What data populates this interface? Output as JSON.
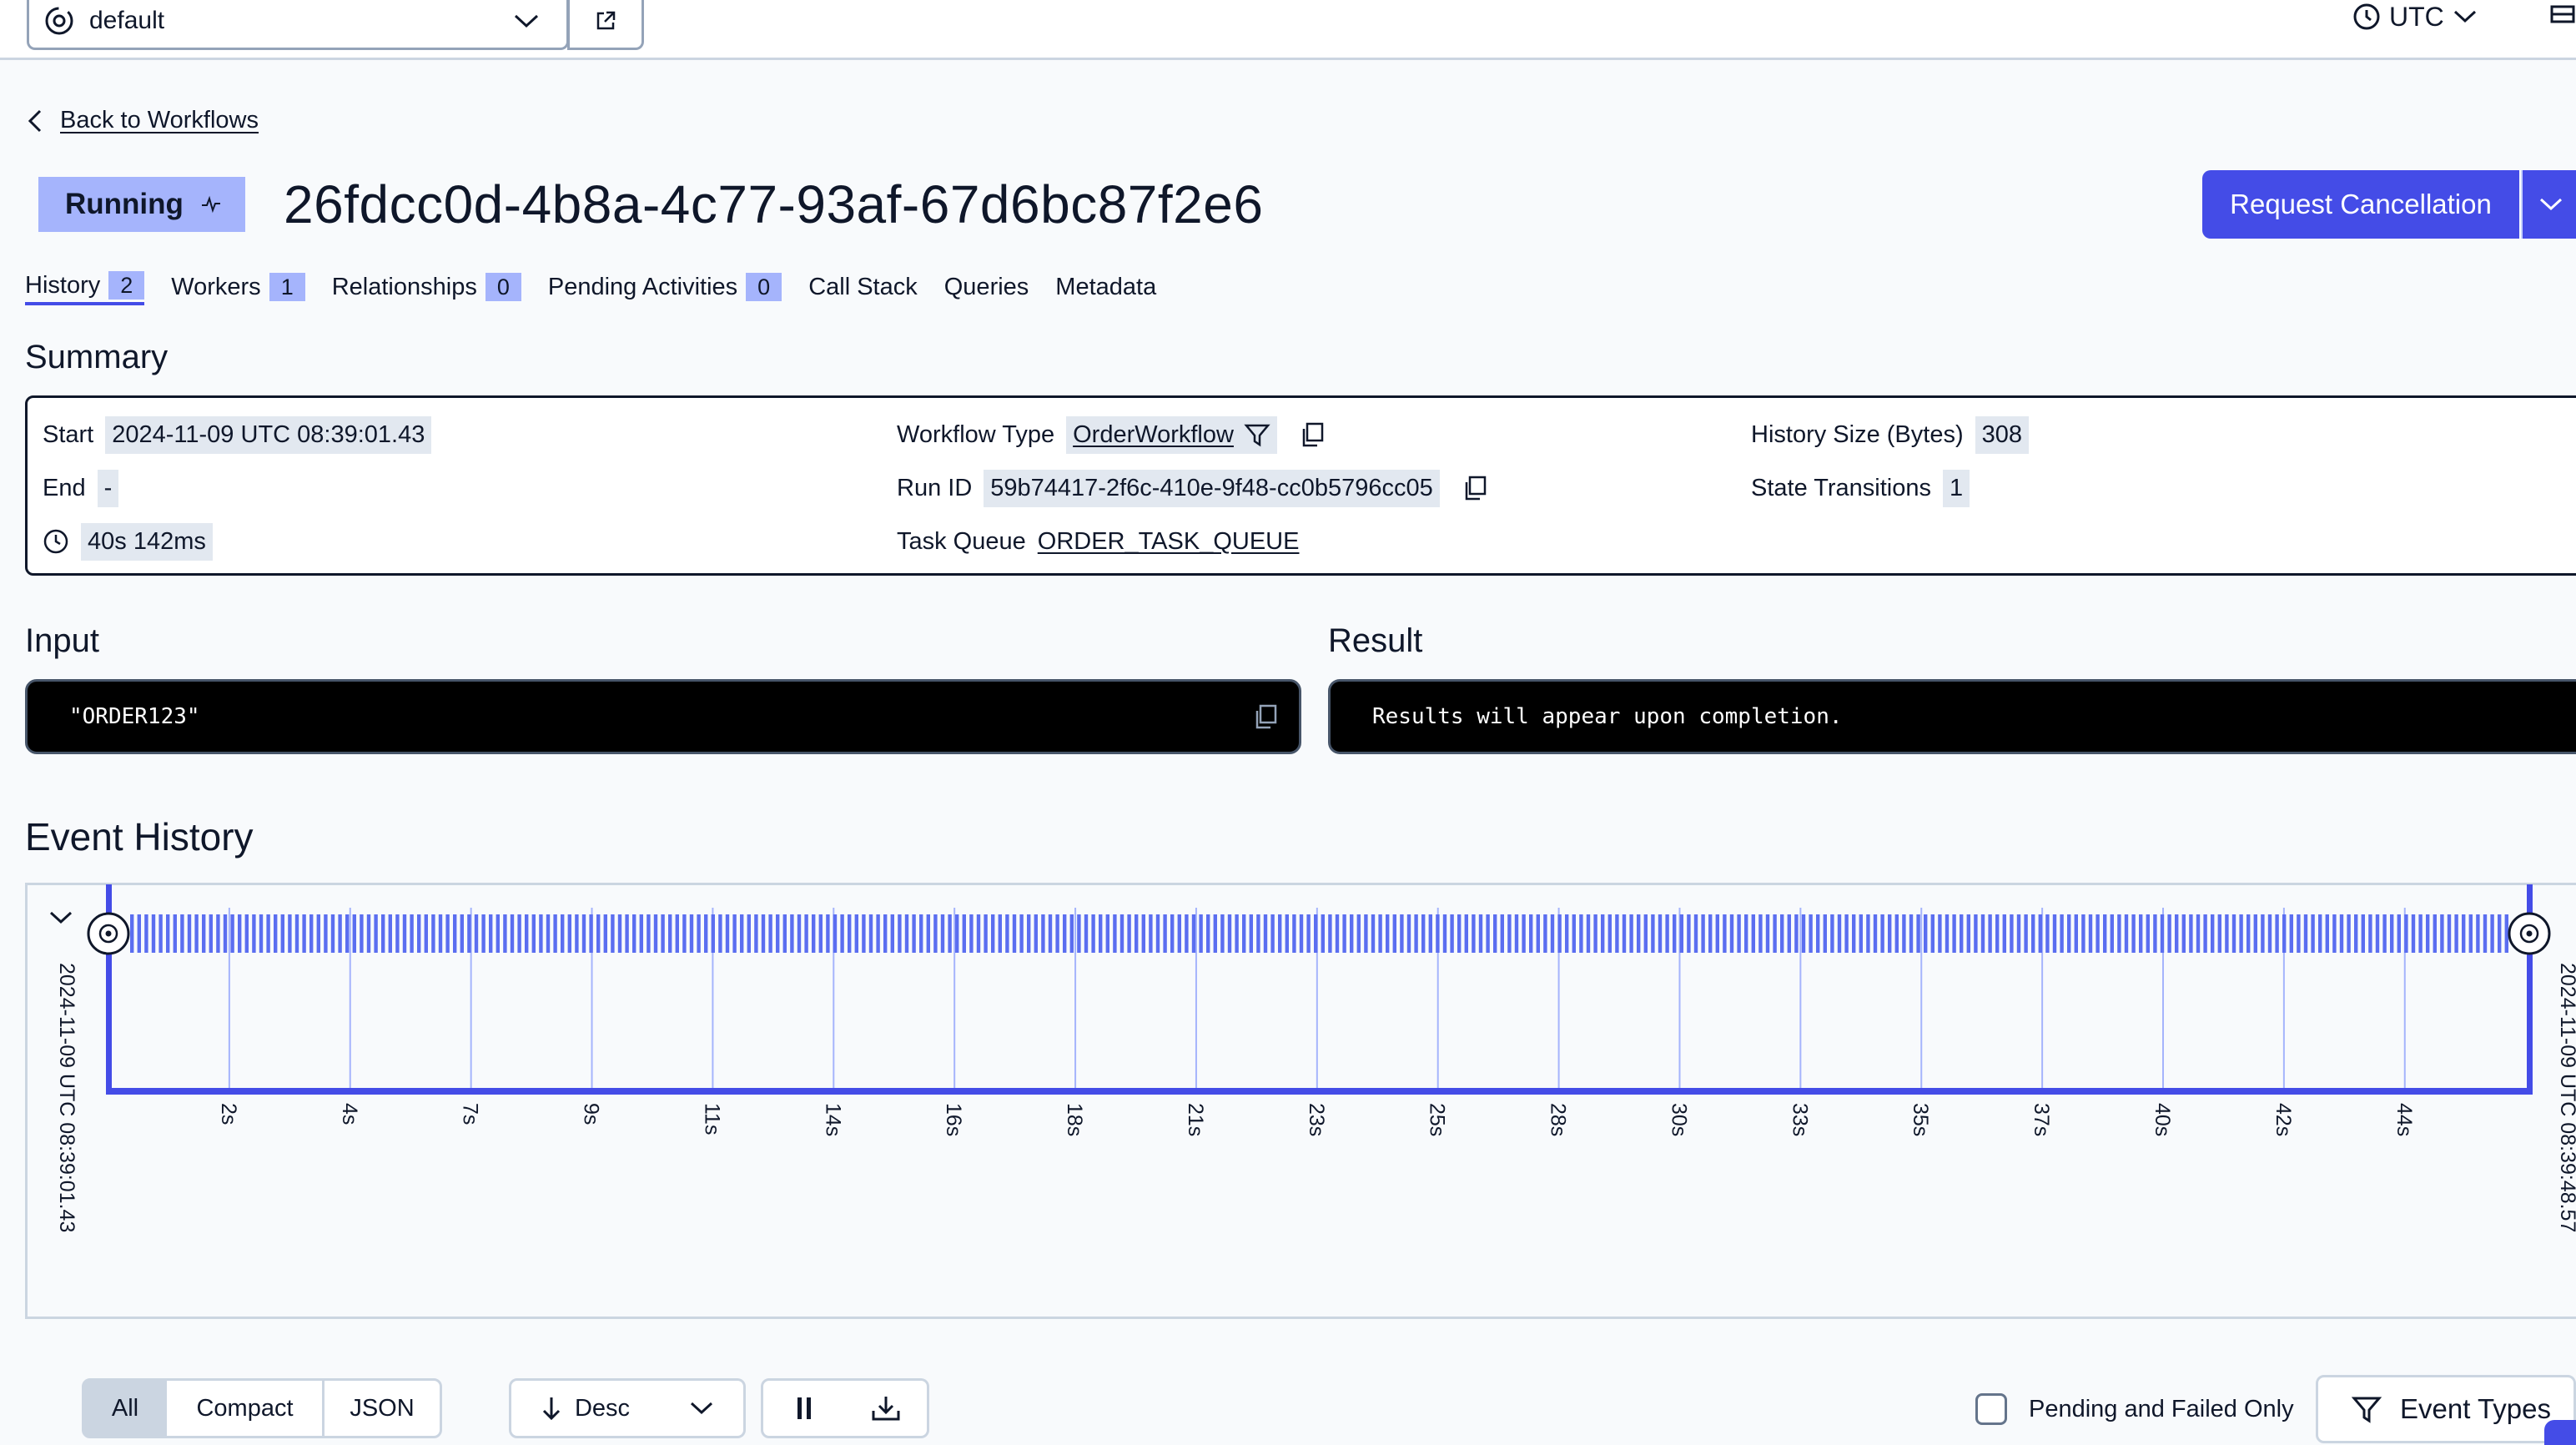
{
  "topbar": {
    "namespace": "default",
    "timezone": "UTC"
  },
  "nav": {
    "back_label": "Back to Workflows"
  },
  "workflow": {
    "status": "Running",
    "id": "26fdcc0d-4b8a-4c77-93af-67d6bc87f2e6",
    "cancel_label": "Request Cancellation"
  },
  "tabs": [
    {
      "label": "History",
      "count": "2"
    },
    {
      "label": "Workers",
      "count": "1"
    },
    {
      "label": "Relationships",
      "count": "0"
    },
    {
      "label": "Pending Activities",
      "count": "0"
    },
    {
      "label": "Call Stack"
    },
    {
      "label": "Queries"
    },
    {
      "label": "Metadata"
    }
  ],
  "summary": {
    "heading": "Summary",
    "start_label": "Start",
    "start_value": "2024-11-09 UTC 08:39:01.43",
    "end_label": "End",
    "end_value": "-",
    "duration_value": "40s 142ms",
    "workflow_type_label": "Workflow Type",
    "workflow_type_value": "OrderWorkflow",
    "run_id_label": "Run ID",
    "run_id_value": "59b74417-2f6c-410e-9f48-cc0b5796cc05",
    "task_queue_label": "Task Queue",
    "task_queue_value": "ORDER_TASK_QUEUE",
    "history_size_label": "History Size (Bytes)",
    "history_size_value": "308",
    "state_transitions_label": "State Transitions",
    "state_transitions_value": "1"
  },
  "io": {
    "input_heading": "Input",
    "input_value": "\"ORDER123\"",
    "result_heading": "Result",
    "result_value": "Results will appear upon completion."
  },
  "event_history": {
    "heading": "Event History",
    "start_time": "2024-11-09 UTC 08:39:01.43",
    "end_time": "2024-11-09 UTC 08:39:48.57",
    "ticks": [
      "2s",
      "4s",
      "7s",
      "9s",
      "11s",
      "14s",
      "16s",
      "18s",
      "21s",
      "23s",
      "25s",
      "28s",
      "30s",
      "33s",
      "35s",
      "37s",
      "40s",
      "42s",
      "44s"
    ],
    "colors": {
      "accent": "#444ce7",
      "bar": "#5b6ef0",
      "grid": "#a5b4fc"
    }
  },
  "controls": {
    "view_all": "All",
    "view_compact": "Compact",
    "view_json": "JSON",
    "sort_label": "Desc",
    "pending_failed_label": "Pending and Failed Only",
    "event_types_label": "Event Types"
  }
}
